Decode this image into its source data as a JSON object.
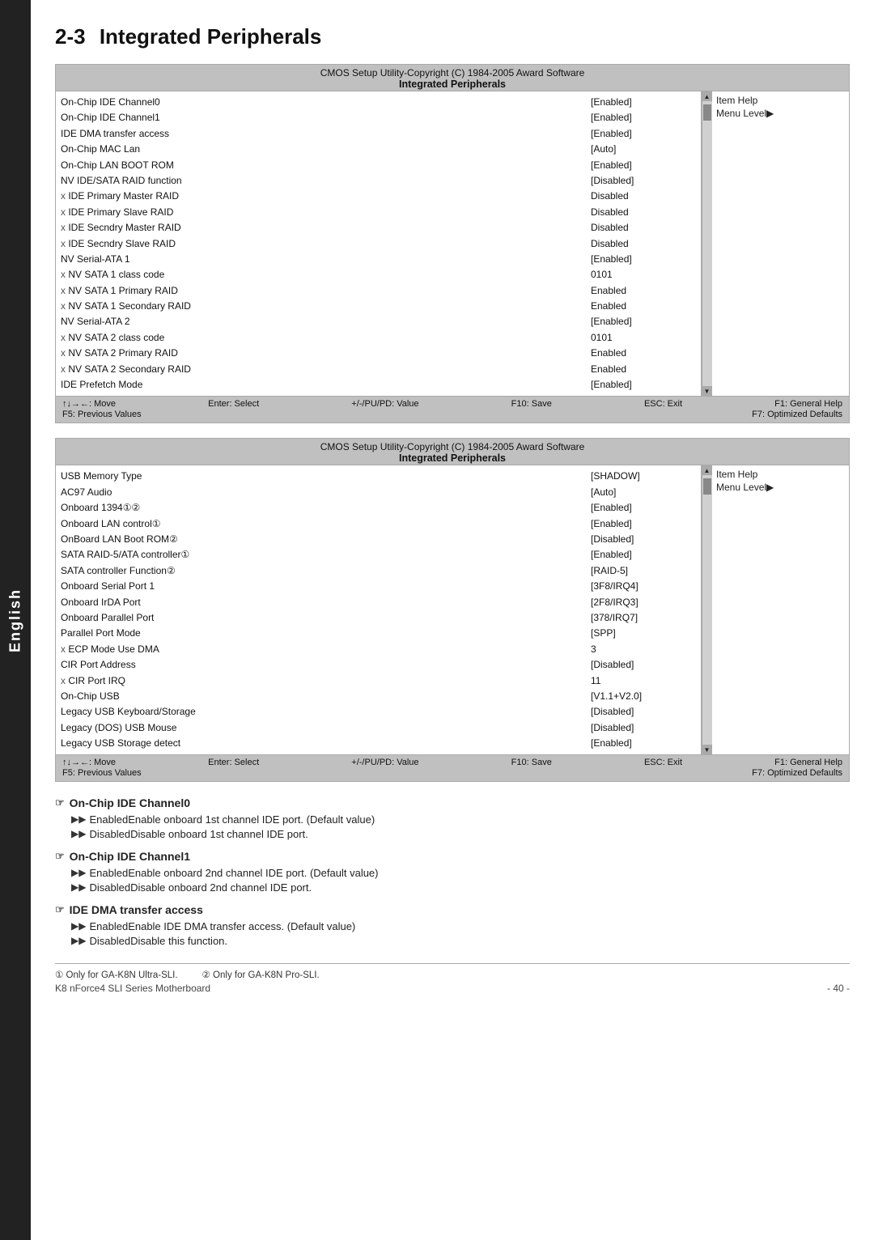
{
  "sidebar": {
    "label": "English"
  },
  "page": {
    "section": "2-3",
    "title": "Integrated Peripherals"
  },
  "bios1": {
    "header_title": "CMOS Setup Utility-Copyright (C) 1984-2005 Award Software",
    "header_subtitle": "Integrated Peripherals",
    "rows": [
      {
        "label": "On-Chip IDE Channel0",
        "value": "[Enabled]",
        "indent": false,
        "x": false
      },
      {
        "label": "On-Chip IDE Channel1",
        "value": "[Enabled]",
        "indent": false,
        "x": false
      },
      {
        "label": "IDE DMA transfer access",
        "value": "[Enabled]",
        "indent": false,
        "x": false
      },
      {
        "label": "On-Chip MAC Lan",
        "value": "[Auto]",
        "indent": false,
        "x": false
      },
      {
        "label": "On-Chip LAN BOOT ROM",
        "value": "[Enabled]",
        "indent": false,
        "x": false
      },
      {
        "label": "NV IDE/SATA RAID function",
        "value": "[Disabled]",
        "indent": false,
        "x": false
      },
      {
        "label": "IDE Primary Master RAID",
        "value": "Disabled",
        "indent": false,
        "x": true
      },
      {
        "label": "IDE Primary Slave RAID",
        "value": "Disabled",
        "indent": false,
        "x": true
      },
      {
        "label": "IDE Secndry Master RAID",
        "value": "Disabled",
        "indent": false,
        "x": true
      },
      {
        "label": "IDE Secndry Slave RAID",
        "value": "Disabled",
        "indent": false,
        "x": true
      },
      {
        "label": "NV Serial-ATA 1",
        "value": "[Enabled]",
        "indent": false,
        "x": false
      },
      {
        "label": "NV SATA 1 class code",
        "value": "0101",
        "indent": false,
        "x": true
      },
      {
        "label": "NV SATA 1 Primary RAID",
        "value": "Enabled",
        "indent": false,
        "x": true
      },
      {
        "label": "NV SATA 1 Secondary RAID",
        "value": "Enabled",
        "indent": false,
        "x": true
      },
      {
        "label": "NV Serial-ATA 2",
        "value": "[Enabled]",
        "indent": false,
        "x": false
      },
      {
        "label": "NV SATA 2 class code",
        "value": "0101",
        "indent": false,
        "x": true
      },
      {
        "label": "NV SATA 2 Primary RAID",
        "value": "Enabled",
        "indent": false,
        "x": true
      },
      {
        "label": "NV SATA 2 Secondary RAID",
        "value": "Enabled",
        "indent": false,
        "x": true
      },
      {
        "label": "IDE Prefetch Mode",
        "value": "[Enabled]",
        "indent": false,
        "x": false
      }
    ],
    "help": {
      "item1": "Item Help",
      "item2": "Menu Level▶"
    },
    "footer": {
      "row1": [
        {
          "key": "↑↓→←: Move",
          "val": ""
        },
        {
          "key": "Enter: Select",
          "val": ""
        },
        {
          "key": "+/-/PU/PD: Value",
          "val": ""
        },
        {
          "key": "F10: Save",
          "val": ""
        },
        {
          "key": "ESC: Exit",
          "val": ""
        },
        {
          "key": "F1: General Help",
          "val": ""
        }
      ],
      "row2_left": "F5: Previous Values",
      "row2_right": "F7: Optimized Defaults"
    }
  },
  "bios2": {
    "header_title": "CMOS Setup Utility-Copyright (C) 1984-2005 Award Software",
    "header_subtitle": "Integrated Peripherals",
    "rows": [
      {
        "label": "USB Memory Type",
        "value": "[SHADOW]",
        "indent": false,
        "x": false
      },
      {
        "label": "AC97 Audio",
        "value": "[Auto]",
        "indent": false,
        "x": false
      },
      {
        "label": "Onboard 1394①②",
        "value": "[Enabled]",
        "indent": false,
        "x": false
      },
      {
        "label": "Onboard LAN control①",
        "value": "[Enabled]",
        "indent": false,
        "x": false
      },
      {
        "label": "OnBoard LAN Boot ROM②",
        "value": "[Disabled]",
        "indent": false,
        "x": false
      },
      {
        "label": "SATA RAID-5/ATA controller①",
        "value": "[Enabled]",
        "indent": false,
        "x": false
      },
      {
        "label": "SATA controller Function②",
        "value": "[RAID-5]",
        "indent": false,
        "x": false
      },
      {
        "label": "Onboard Serial Port 1",
        "value": "[3F8/IRQ4]",
        "indent": false,
        "x": false
      },
      {
        "label": "Onboard IrDA Port",
        "value": "[2F8/IRQ3]",
        "indent": false,
        "x": false
      },
      {
        "label": "Onboard Parallel Port",
        "value": "[378/IRQ7]",
        "indent": false,
        "x": false
      },
      {
        "label": "Parallel Port Mode",
        "value": "[SPP]",
        "indent": false,
        "x": false
      },
      {
        "label": "ECP Mode Use DMA",
        "value": "3",
        "indent": false,
        "x": true
      },
      {
        "label": "CIR Port Address",
        "value": "[Disabled]",
        "indent": false,
        "x": false
      },
      {
        "label": "CIR Port IRQ",
        "value": "11",
        "indent": false,
        "x": true
      },
      {
        "label": "On-Chip USB",
        "value": "[V1.1+V2.0]",
        "indent": false,
        "x": false
      },
      {
        "label": "Legacy USB Keyboard/Storage",
        "value": "[Disabled]",
        "indent": false,
        "x": false
      },
      {
        "label": "Legacy (DOS) USB Mouse",
        "value": "[Disabled]",
        "indent": false,
        "x": false
      },
      {
        "label": "Legacy USB Storage detect",
        "value": "[Enabled]",
        "indent": false,
        "x": false
      }
    ],
    "help": {
      "item1": "Item Help",
      "item2": "Menu Level▶"
    },
    "footer": {
      "row1_move": "↑↓→←: Move",
      "row1_enter": "Enter: Select",
      "row1_value": "+/-/PU/PD: Value",
      "row1_save": "F10: Save",
      "row1_exit": "ESC: Exit",
      "row1_help": "F1: General Help",
      "row2_left": "F5: Previous Values",
      "row2_right": "F7: Optimized Defaults"
    }
  },
  "descriptions": [
    {
      "id": "on-chip-ide0",
      "title": "On-Chip IDE Channel0",
      "items": [
        {
          "bullet": "Enabled",
          "text": "Enable onboard 1st channel IDE port. (Default value)"
        },
        {
          "bullet": "Disabled",
          "text": "Disable onboard 1st channel IDE port."
        }
      ]
    },
    {
      "id": "on-chip-ide1",
      "title": "On-Chip IDE Channel1",
      "items": [
        {
          "bullet": "Enabled",
          "text": "Enable onboard 2nd channel IDE port. (Default value)"
        },
        {
          "bullet": "Disabled",
          "text": "Disable onboard 2nd channel IDE port."
        }
      ]
    },
    {
      "id": "ide-dma",
      "title": "IDE DMA transfer access",
      "items": [
        {
          "bullet": "Enabled",
          "text": "Enable IDE DMA transfer access. (Default value)"
        },
        {
          "bullet": "Disabled",
          "text": "Disable this function."
        }
      ]
    }
  ],
  "footer": {
    "note1": "① Only for GA-K8N Ultra-SLI.",
    "note2": "② Only for GA-K8N Pro-SLI.",
    "product": "K8 nForce4 SLI Series Motherboard",
    "page": "- 40 -"
  }
}
